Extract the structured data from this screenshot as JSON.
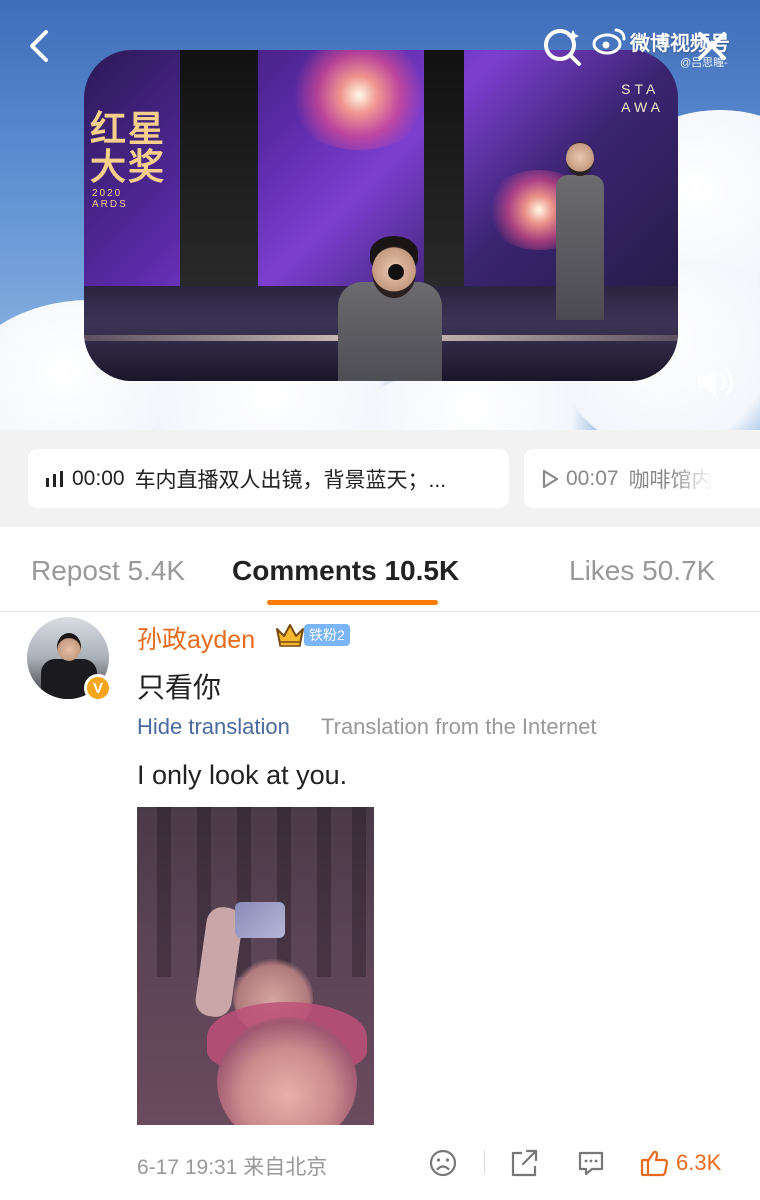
{
  "top_bar": {
    "weibo_brand": "微博视频号",
    "watermark_handle": "@吕思瞳-"
  },
  "video": {
    "stage_logo": "红星\n大奖",
    "stage_logo_small": "2020\nARDS",
    "star_awards_text": "STA\nAWA"
  },
  "chapters": [
    {
      "time": "00:00",
      "text": "车内直播双人出镜，背景蓝天；...",
      "active": true
    },
    {
      "time": "00:07",
      "text": "咖啡馆内",
      "active": false
    }
  ],
  "tabs": {
    "repost": "Repost 5.4K",
    "comments": "Comments 10.5K",
    "likes": "Likes 50.7K",
    "active": "comments"
  },
  "comment": {
    "username": "孙政ayden",
    "verified_badge": "V",
    "fan_badge": "铁粉2",
    "text": "只看你",
    "hide_translation": "Hide translation",
    "translation_source": "Translation from the Internet",
    "translated_text": "I only look at you.",
    "date": "6-17 19:31 来自北京",
    "like_count": "6.3K"
  },
  "colors": {
    "accent": "#ff7a00",
    "username": "#e86a1b",
    "translation_link": "#4a6a9e",
    "fan_badge": "#79b5f7",
    "verified": "#f7a51c"
  },
  "icons": {
    "back": "chevron-left-icon",
    "search": "search-icon",
    "close": "close-icon",
    "volume": "volume-icon",
    "chapter_active": "audio-bars-icon",
    "chapter_inactive": "play-icon",
    "crown": "crown-icon",
    "dislike": "frown-face-icon",
    "share": "share-icon",
    "reply": "comment-icon",
    "like": "thumbs-up-icon"
  }
}
